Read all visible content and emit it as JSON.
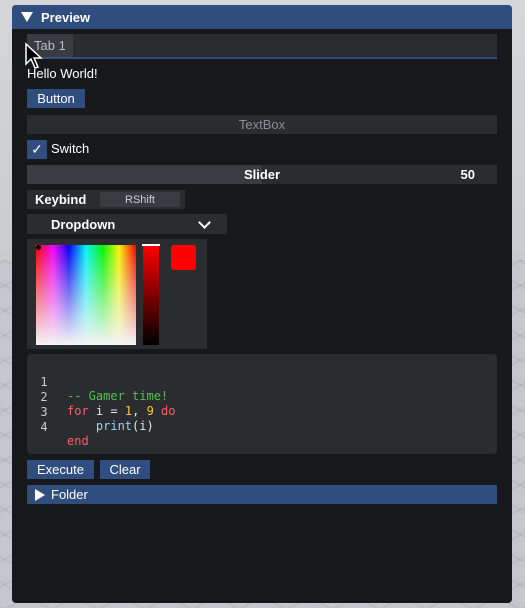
{
  "window": {
    "title": "Preview"
  },
  "tabs": [
    {
      "label": "Tab 1"
    }
  ],
  "content": {
    "hello_text": "Hello World!",
    "button_label": "Button",
    "textbox_placeholder": "TextBox",
    "switch": {
      "label": "Switch",
      "checked": true,
      "check_glyph": "✓"
    },
    "slider": {
      "label": "Slider",
      "value": "50",
      "fill_fraction": 0.5
    },
    "keybind": {
      "label": "Keybind",
      "key": "RShift"
    },
    "dropdown": {
      "selected": "Dropdown"
    },
    "color_picker": {
      "color": "#FF0000"
    },
    "code_editor": {
      "lines": [
        {
          "number": "1",
          "text": "-- Gamer time!"
        },
        {
          "number": "2",
          "text": "for i = 1, 9 do"
        },
        {
          "number": "3",
          "text": "    print(i)"
        },
        {
          "number": "4",
          "text": "end"
        }
      ]
    },
    "execute_label": "Execute",
    "clear_label": "Clear",
    "folder_label": "Folder"
  },
  "colors": {
    "accent": "#2F4E7E",
    "window_bg": "#17181B",
    "element_bg": "#2B2C30",
    "comment": "#4FC24F",
    "keyword": "#FF5E6B",
    "number": "#FFC93B",
    "builtin": "#8FD6FF"
  },
  "icons": {
    "collapse": "triangle-down-icon",
    "expand": "triangle-right-icon",
    "checkmark": "checkmark-icon",
    "chevron": "chevron-down-icon",
    "pointer": "mouse-cursor-icon"
  }
}
